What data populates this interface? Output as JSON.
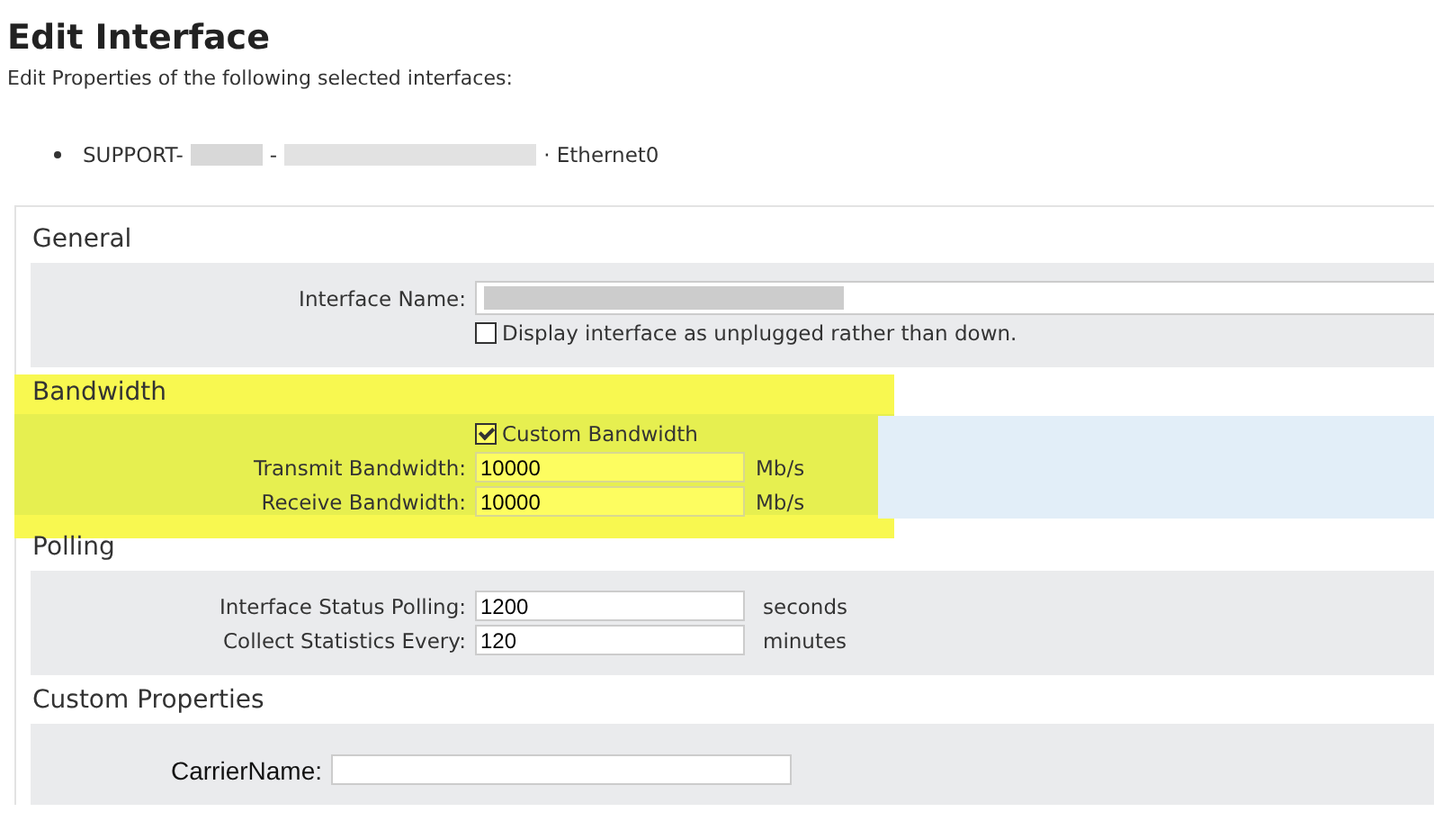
{
  "title": "Edit Interface",
  "subtitle": "Edit Properties of the following selected interfaces:",
  "interfaces": [
    {
      "segments": [
        {
          "kind": "text",
          "text": "SUPPORT-"
        },
        {
          "kind": "redacted"
        },
        {
          "kind": "text",
          "text": "-"
        },
        {
          "kind": "redacted"
        },
        {
          "kind": "text",
          "text": "· Ethernet0"
        }
      ]
    }
  ],
  "sections": [
    {
      "title": "General",
      "highlighted": false,
      "fields": [
        {
          "kind": "redacted-input",
          "label": "Interface Name:"
        },
        {
          "kind": "checkbox",
          "label": "Display interface as unplugged rather than down.",
          "checked": false
        }
      ]
    },
    {
      "title": "Bandwidth",
      "highlighted": true,
      "fields": [
        {
          "kind": "checkbox",
          "label": "Custom Bandwidth",
          "checked": true
        },
        {
          "kind": "input",
          "label": "Transmit Bandwidth:",
          "value": "10000",
          "unit": "Mb/s"
        },
        {
          "kind": "input",
          "label": "Receive Bandwidth:",
          "value": "10000",
          "unit": "Mb/s"
        }
      ]
    },
    {
      "title": "Polling",
      "highlighted": false,
      "fields": [
        {
          "kind": "input",
          "label": "Interface Status Polling:",
          "value": "1200",
          "unit": "seconds"
        },
        {
          "kind": "input",
          "label": "Collect Statistics Every:",
          "value": "120",
          "unit": "minutes"
        }
      ]
    },
    {
      "title": "Custom Properties",
      "highlighted": false,
      "fields": [
        {
          "kind": "custom",
          "label": "CarrierName:"
        }
      ]
    }
  ]
}
